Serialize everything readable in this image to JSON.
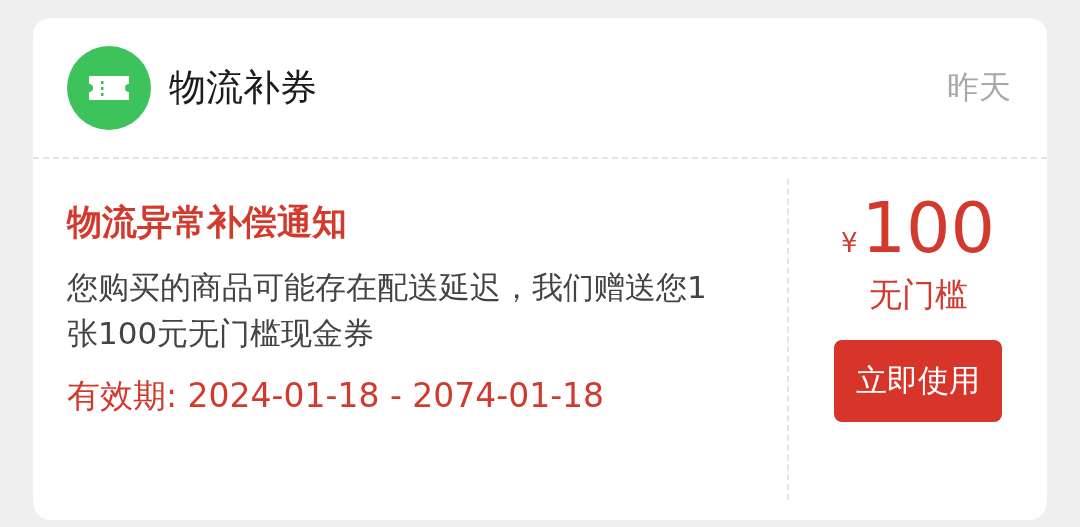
{
  "header": {
    "title": "物流补券",
    "time": "昨天"
  },
  "notice": {
    "title": "物流异常补偿通知",
    "description": "您购买的商品可能存在配送延迟，我们赠送您1张100元无门槛现金券",
    "validity": "有效期: 2024-01-18 - 2074-01-18"
  },
  "coupon": {
    "currency": "¥",
    "amount": "100",
    "condition": "无门槛",
    "button": "立即使用"
  }
}
